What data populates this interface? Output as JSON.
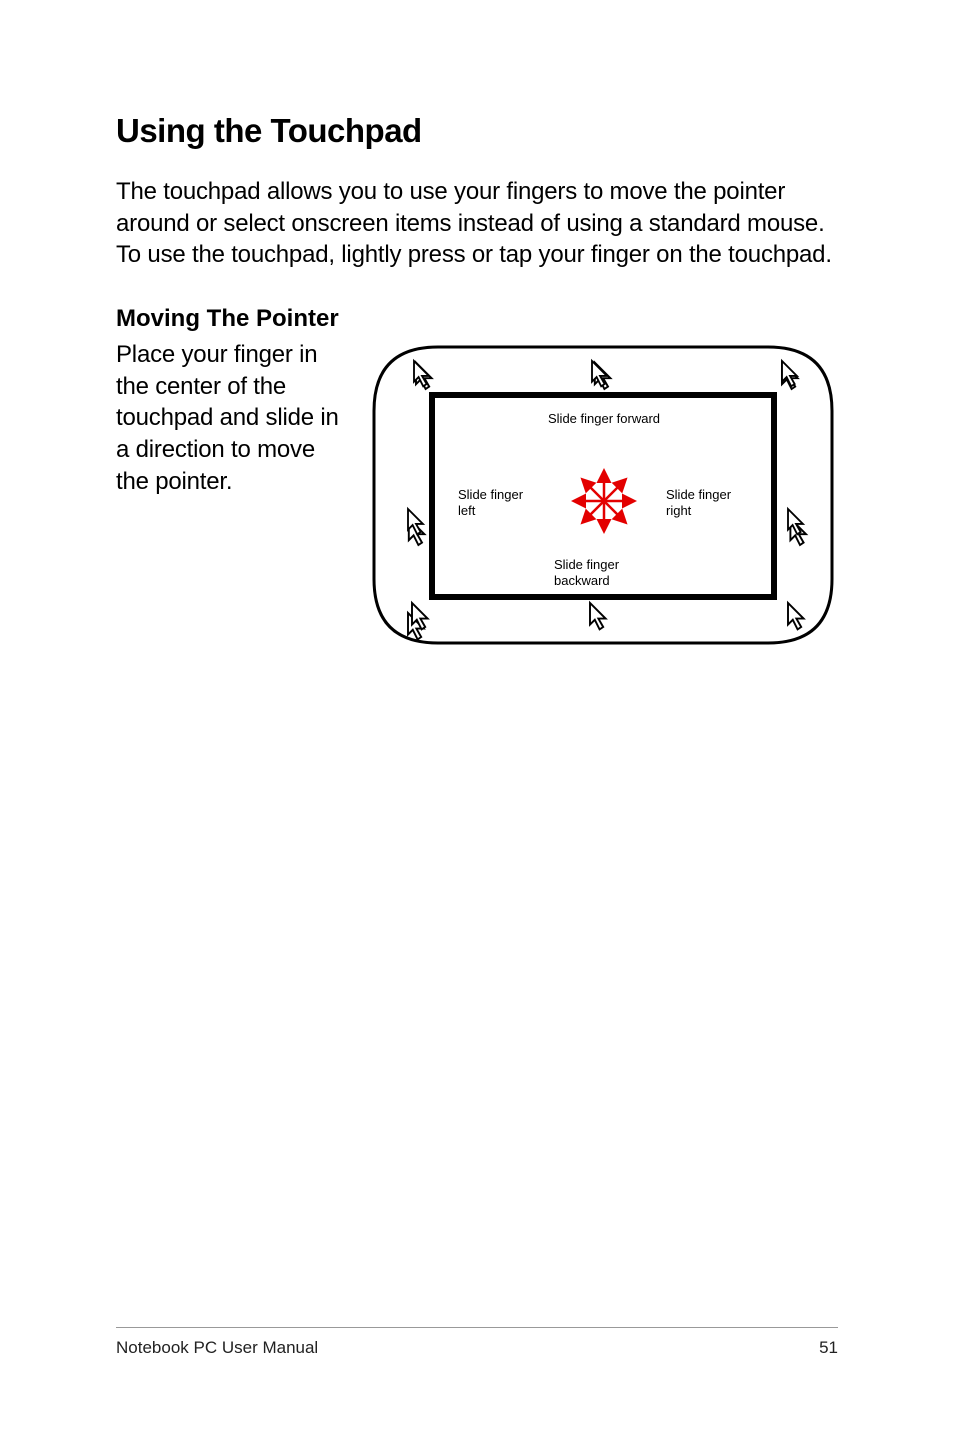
{
  "title": "Using the Touchpad",
  "intro": "The touchpad allows you to use your fingers to move the pointer around or select onscreen items instead of using a standard mouse. To use the touchpad, lightly press or tap your finger on the touchpad.",
  "subtitle": "Moving The Pointer",
  "body": "Place your finger in the center of the touchpad and slide in a direction to move the pointer.",
  "diagram": {
    "label_forward": "Slide finger forward",
    "label_left_1": "Slide finger",
    "label_left_2": "left",
    "label_right_1": "Slide finger",
    "label_right_2": "right",
    "label_back_1": "Slide finger",
    "label_back_2": "backward"
  },
  "footer": {
    "left": "Notebook PC User Manual",
    "right": "51"
  }
}
